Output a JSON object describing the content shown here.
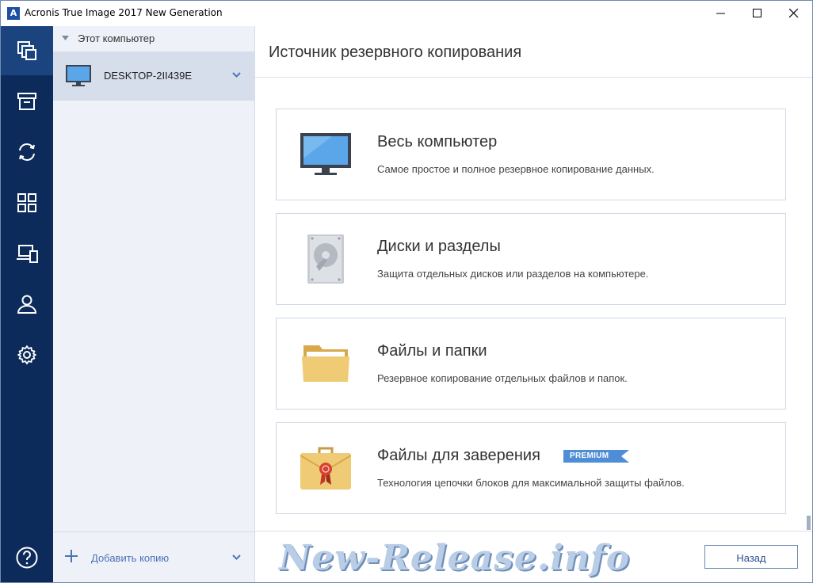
{
  "window": {
    "title": "Acronis True Image 2017 New Generation",
    "logo_letter": "A",
    "brand_color": "#1e50a2"
  },
  "nav": {
    "items": [
      {
        "icon": "backup-icon",
        "active": true
      },
      {
        "icon": "archive-icon",
        "active": false
      },
      {
        "icon": "sync-icon",
        "active": false
      },
      {
        "icon": "dashboard-icon",
        "active": false
      },
      {
        "icon": "tools-icon",
        "active": false
      },
      {
        "icon": "account-icon",
        "active": false
      },
      {
        "icon": "settings-icon",
        "active": false
      }
    ],
    "help_icon": "help-icon",
    "background": "#0c2b5a"
  },
  "sources": {
    "header": "Этот компьютер",
    "machine": "DESKTOP-2II439E",
    "add_label": "Добавить копию"
  },
  "main": {
    "title": "Источник резервного копирования",
    "options": [
      {
        "title": "Весь компьютер",
        "description": "Самое простое и полное резервное копирование данных.",
        "icon": "computer-icon"
      },
      {
        "title": "Диски и разделы",
        "description": "Защита отдельных дисков или разделов на компьютере.",
        "icon": "disk-icon"
      },
      {
        "title": "Файлы и папки",
        "description": "Резервное копирование отдельных файлов и папок.",
        "icon": "folder-icon"
      },
      {
        "title": "Файлы для заверения",
        "description": "Технология цепочки блоков для максимальной защиты файлов.",
        "icon": "notarized-briefcase-icon",
        "badge": "PREMIUM"
      }
    ],
    "back_button": "Назад"
  },
  "watermark": "New-Release.info"
}
